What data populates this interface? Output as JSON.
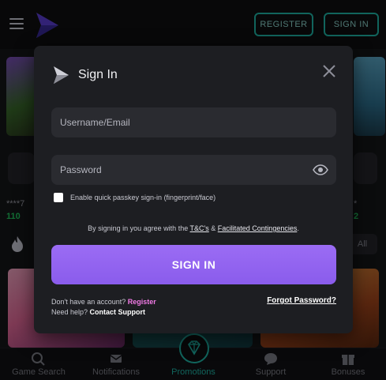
{
  "header": {
    "register_label": "REGISTER",
    "signin_label": "SIGN IN"
  },
  "background": {
    "left_card_stars": "****7",
    "left_card_amount": "110",
    "right_card_stars": "*",
    "right_card_amount": "2",
    "right_filter_label": "All"
  },
  "bottom_nav": {
    "items": [
      {
        "label": "Game Search",
        "icon": "search-icon"
      },
      {
        "label": "Notifications",
        "icon": "envelope-icon"
      },
      {
        "label": "Promotions",
        "icon": "diamond-icon",
        "active": true
      },
      {
        "label": "Support",
        "icon": "chat-bubble-icon"
      },
      {
        "label": "Bonuses",
        "icon": "gift-icon"
      }
    ]
  },
  "modal": {
    "title": "Sign In",
    "username_placeholder": "Username/Email",
    "password_placeholder": "Password",
    "passkey_label": "Enable quick passkey sign-in (fingerprint/face)",
    "terms_prefix": "By signing in you agree with the ",
    "terms_link": "T&C's",
    "terms_mid": " & ",
    "contingencies_link": "Facilitated Contingencies",
    "terms_suffix": ".",
    "signin_button": "SIGN IN",
    "no_account_text": "Don't have an account? ",
    "register_link": "Register",
    "help_text": "Need help? ",
    "support_link": "Contact Support",
    "forgot_link": "Forgot Password?"
  },
  "colors": {
    "accent_teal": "#1fb7a8",
    "button_purple": "#8a5cec",
    "register_pink": "#f27be6",
    "modal_bg": "#1d1e22",
    "input_bg": "#2a2b30"
  }
}
